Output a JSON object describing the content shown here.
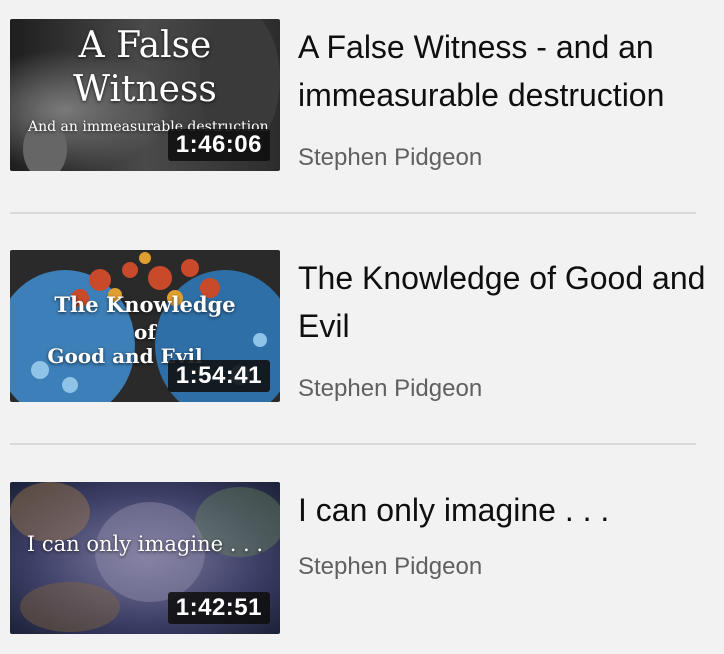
{
  "videos": [
    {
      "thumb_title": "A False",
      "thumb_title2": "Witness",
      "thumb_sub": "And an immeasurable destruction",
      "duration": "1:46:06",
      "title": "A False Witness - and an immeasurable destruction",
      "channel": "Stephen Pidgeon"
    },
    {
      "thumb_title": "The Knowledge",
      "thumb_title2": "of",
      "thumb_sub": "Good and Evil",
      "duration": "1:54:41",
      "title": "The Knowledge of Good and Evil",
      "channel": "Stephen Pidgeon"
    },
    {
      "thumb_title": "I can only imagine . . .",
      "duration": "1:42:51",
      "title": "I can only imagine . . .",
      "channel": "Stephen Pidgeon"
    }
  ]
}
